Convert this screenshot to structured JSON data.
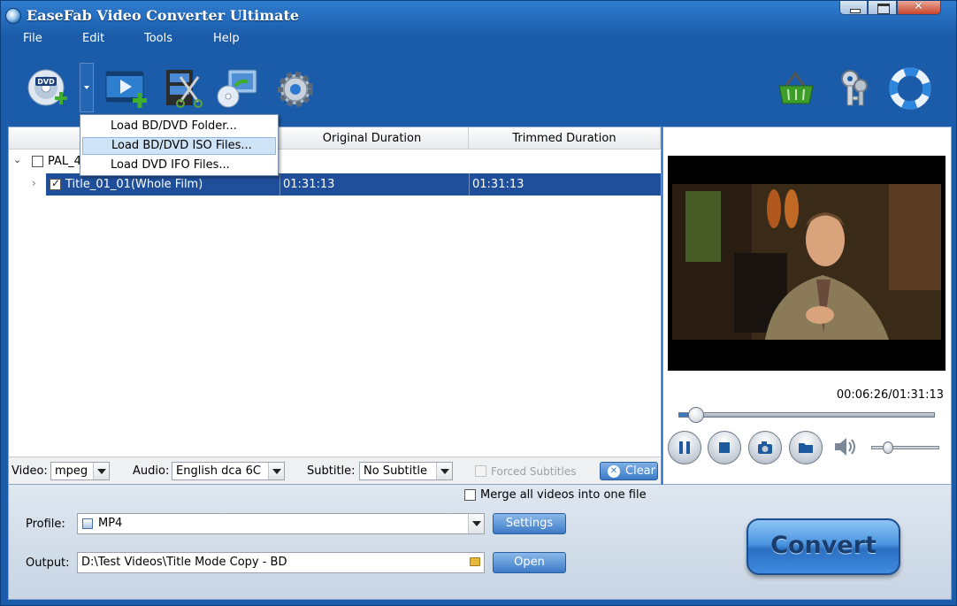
{
  "window": {
    "title": "EaseFab Video Converter Ultimate"
  },
  "menu": {
    "file": "File",
    "edit": "Edit",
    "tools": "Tools",
    "help": "Help"
  },
  "toolbar": {
    "icons": [
      "load-dvd-icon",
      "add-video-icon",
      "edit-video-icon",
      "add-disc-icon",
      "settings-gear-icon",
      "shopping-basket-icon",
      "register-keys-icon",
      "help-lifebuoy-icon"
    ]
  },
  "dvd_menu": {
    "items": [
      "Load BD/DVD Folder...",
      "Load BD/DVD ISO Files...",
      "Load DVD IFO Files..."
    ]
  },
  "list": {
    "columns": {
      "original": "Original Duration",
      "trimmed": "Trimmed Duration"
    },
    "group_name": "PAL_4",
    "rows": [
      {
        "name": "Title_01_01(Whole Film)",
        "original": "01:31:13",
        "trimmed": "01:31:13",
        "checked": true
      }
    ]
  },
  "tracks": {
    "video_label": "Video:",
    "video_value": "mpeg",
    "audio_label": "Audio:",
    "audio_value": "English dca 6C",
    "subtitle_label": "Subtitle:",
    "subtitle_value": "No Subtitle",
    "forced_label": "Forced Subtitles",
    "clear_label": "Clear"
  },
  "player": {
    "timecode": "00:06:26/01:31:13",
    "progress": 0.07,
    "volume": 0.25
  },
  "bottom": {
    "merge_label": "Merge all videos into one file",
    "profile_label": "Profile:",
    "profile_value": "MP4",
    "output_label": "Output:",
    "output_value": "D:\\Test Videos\\Title Mode Copy - BD",
    "settings_label": "Settings",
    "open_label": "Open",
    "convert_label": "Convert"
  },
  "colors": {
    "selection": "#1f4f9a",
    "frame": "#1a5ca9",
    "accent": "#3d7bc6"
  }
}
